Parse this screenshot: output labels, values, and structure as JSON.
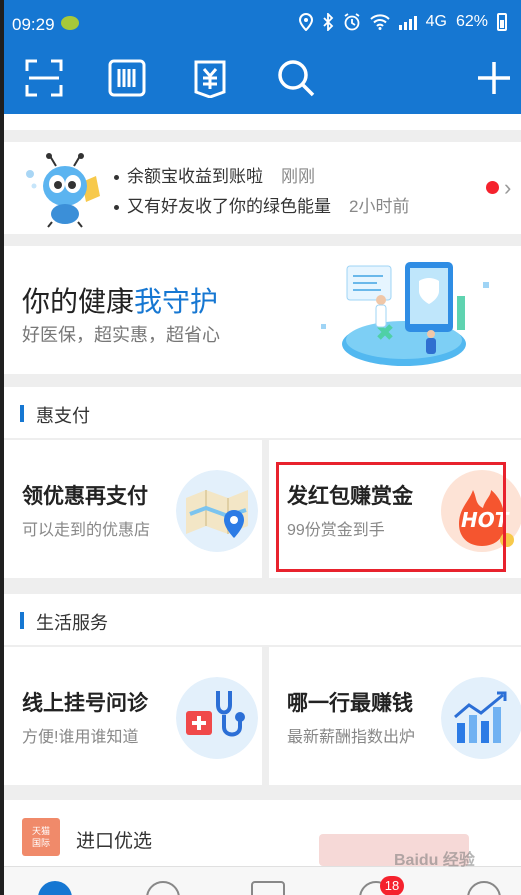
{
  "status_bar": {
    "time": "09:29",
    "network": "4G",
    "battery": "62%"
  },
  "toolbar": {
    "icons": [
      "scan-icon",
      "pay-code-icon",
      "bill-icon",
      "search-icon",
      "add-icon"
    ]
  },
  "notifications": [
    {
      "text": "余额宝收益到账啦",
      "time": "刚刚"
    },
    {
      "text": "又有好友收了你的绿色能量",
      "time": "2小时前"
    }
  ],
  "health_banner": {
    "title_prefix": "你的健康",
    "title_accent": "我守护",
    "subtitle": "好医保，超实惠，超省心"
  },
  "sections": {
    "hui_pay": {
      "title": "惠支付",
      "tiles": [
        {
          "title": "领优惠再支付",
          "subtitle": "可以走到的优惠店",
          "icon": "map-pin-icon"
        },
        {
          "title": "发红包赚赏金",
          "subtitle": "99份赏金到手",
          "icon": "hot-flame-icon",
          "icon_text": "HOT"
        }
      ]
    },
    "life_services": {
      "title": "生活服务",
      "tiles": [
        {
          "title": "线上挂号问诊",
          "subtitle": "方便!谁用谁知道",
          "icon": "stethoscope-icon"
        },
        {
          "title": "哪一行最赚钱",
          "subtitle": "最新薪酬指数出炉",
          "icon": "bar-chart-icon"
        }
      ]
    }
  },
  "import_select": {
    "logo_text": "天猫\n国际",
    "label": "进口优选"
  },
  "tabbar": {
    "badge": "18"
  },
  "watermark": "Baidu 经验",
  "colors": {
    "brand_blue": "#1677d2",
    "highlight_red": "#e8222d",
    "hot_orange": "#f5552f"
  }
}
